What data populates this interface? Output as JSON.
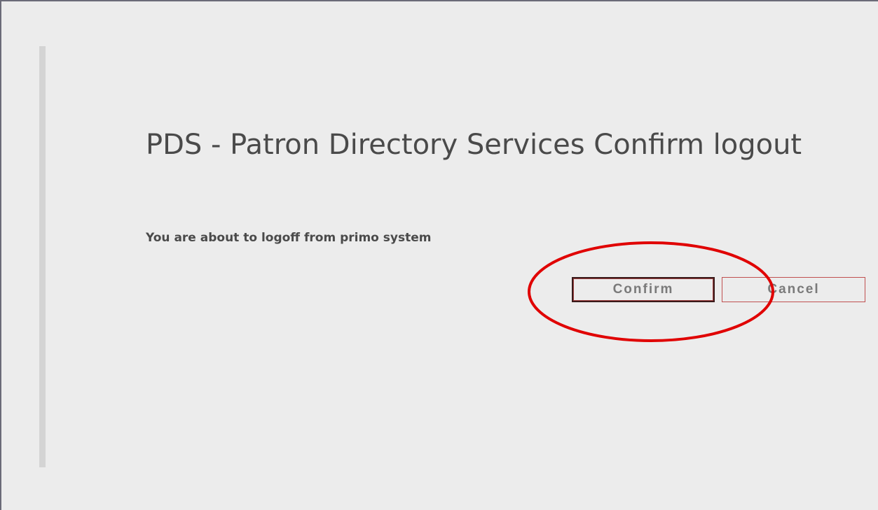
{
  "dialog": {
    "title": "PDS - Patron Directory Services Confirm logout",
    "message": "You are about to logoff from primo system",
    "confirm_label": "Confirm",
    "cancel_label": "Cancel"
  },
  "annotation": {
    "highlight_color": "#e00000",
    "highlight_target": "confirm-button"
  },
  "colors": {
    "background": "#ececec",
    "text": "#4a4a4a",
    "button_text": "#7a7a7a",
    "cancel_border": "#c05050"
  }
}
